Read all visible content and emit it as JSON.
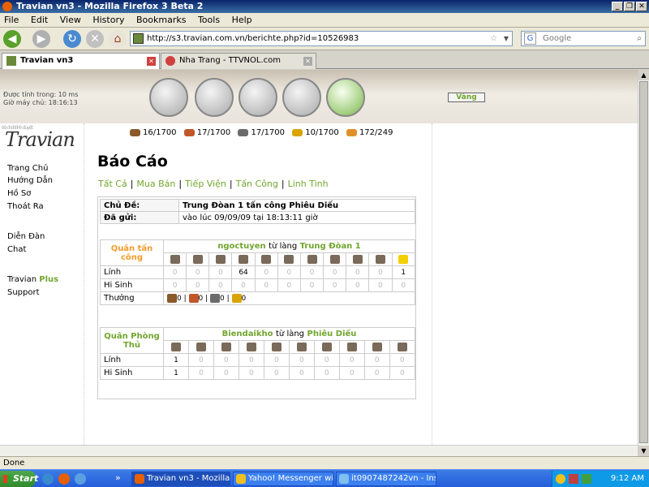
{
  "window": {
    "title": "Travian vn3 - Mozilla Firefox 3 Beta 2"
  },
  "menu": [
    "File",
    "Edit",
    "View",
    "History",
    "Bookmarks",
    "Tools",
    "Help"
  ],
  "address": {
    "url": "http://s3.travian.com.vn/berichte.php?id=10526983"
  },
  "search": {
    "placeholder": "Google"
  },
  "tabs": [
    {
      "label": "Travian vn3"
    },
    {
      "label": "Nha Trang - TTVNOL.com"
    }
  ],
  "header": {
    "ping_label": "Được tính trong: 10 ms",
    "server_time": "Giờ máy chủ: 18:16:13",
    "gold_button": "Vàng"
  },
  "logo": {
    "text": "Travian",
    "sub": "trò chơi trình duyệt"
  },
  "leftmenu": {
    "home": "Trang Chủ",
    "guide": "Hướng Dẫn",
    "profile": "Hồ Sơ",
    "logout": "Thoát Ra",
    "forum": "Diễn Đàn",
    "chat": "Chat",
    "plus_prefix": "Travian",
    "plus": "Plus",
    "support": "Support"
  },
  "resources": [
    {
      "icon": "wood-icon",
      "color": "#8b5a2b",
      "text": "16/1700"
    },
    {
      "icon": "clay-icon",
      "color": "#c0562a",
      "text": "17/1700"
    },
    {
      "icon": "iron-icon",
      "color": "#6b6b6b",
      "text": "17/1700"
    },
    {
      "icon": "crop-icon",
      "color": "#d9a400",
      "text": "10/1700"
    },
    {
      "icon": "crop-consumption-icon",
      "color": "#e0902a",
      "text": "172/249"
    }
  ],
  "page": {
    "heading": "Báo Cáo"
  },
  "subnav": [
    "Tất Cả",
    "Mua Bán",
    "Tiếp Viện",
    "Tấn Công",
    "Linh Tinh"
  ],
  "report": {
    "subject_label": "Chủ Đề:",
    "subject": "Trung Đòan 1 tấn công Phiêu Diếu",
    "sent_label": "Đã gửi:",
    "sent": "vào lúc 09/09/09 tại 18:13:11 giờ"
  },
  "attacker": {
    "header": "Quân tấn công",
    "player": "ngoctuyen",
    "from_word": "từ làng",
    "village": "Trung Đòan 1",
    "units_label": "Lính",
    "units": [
      "0",
      "0",
      "0",
      "64",
      "0",
      "0",
      "0",
      "0",
      "0",
      "0",
      "1"
    ],
    "losses_label": "Hi Sinh",
    "losses": [
      "0",
      "0",
      "0",
      "0",
      "0",
      "0",
      "0",
      "0",
      "0",
      "0",
      "0"
    ],
    "bounty_label": "Thưởng",
    "bounty": [
      "0",
      "0",
      "0",
      "0"
    ],
    "unit_icons": [
      "axe-icon",
      "spear-icon",
      "helmet-icon",
      "scout-icon",
      "horse-icon",
      "cavalry-icon",
      "ram-icon",
      "catapult-icon",
      "chief-icon",
      "settler-icon",
      "hero-star-icon"
    ]
  },
  "defender": {
    "header": "Quân Phòng Thủ",
    "player": "Biendaikho",
    "from_word": "từ làng",
    "village": "Phiêu Diếu",
    "units_label": "Lính",
    "units": [
      "1",
      "0",
      "0",
      "0",
      "0",
      "0",
      "0",
      "0",
      "0",
      "0"
    ],
    "losses_label": "Hi Sinh",
    "losses": [
      "1",
      "0",
      "0",
      "0",
      "0",
      "0",
      "0",
      "0",
      "0",
      "0"
    ],
    "unit_icons": [
      "sword-icon",
      "lance-icon",
      "pike-icon",
      "soldier-icon",
      "horse-icon",
      "cavalry-icon",
      "ram-icon",
      "catapult-icon",
      "chief-icon",
      "settler-icon"
    ]
  },
  "status": {
    "text": "Done"
  },
  "taskbar": {
    "start": "Start",
    "tasks": [
      "Travian vn3 - Mozilla ...",
      "Yahoo! Messenger with ...",
      "it0907487242vn - Instan..."
    ],
    "clock": "9:12 AM"
  }
}
